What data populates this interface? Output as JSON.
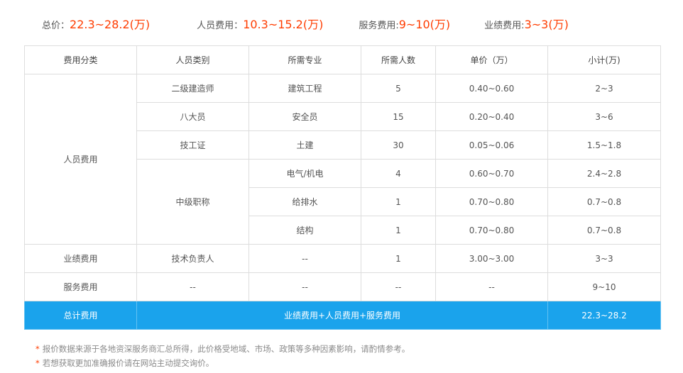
{
  "summary": {
    "total_label": "总价：",
    "total_value": "22.3~28.2(万)",
    "personnel_label": "人员费用：",
    "personnel_value": "10.3~15.2(万)",
    "service_label": "服务费用:",
    "service_value": "9~10(万)",
    "performance_label": "业绩费用:",
    "performance_value": "3~3(万)"
  },
  "table": {
    "headers": [
      "费用分类",
      "人员类别",
      "所需专业",
      "所需人数",
      "单价（万）",
      "小计(万)"
    ],
    "personnel_group": "人员费用",
    "rows": [
      {
        "category": "二级建造师",
        "major": "建筑工程",
        "count": "5",
        "price": "0.40~0.60",
        "subtotal": "2~3"
      },
      {
        "category": "八大员",
        "major": "安全员",
        "count": "15",
        "price": "0.20~0.40",
        "subtotal": "3~6"
      },
      {
        "category": "技工证",
        "major": "土建",
        "count": "30",
        "price": "0.05~0.06",
        "subtotal": "1.5~1.8"
      },
      {
        "category": "中级职称",
        "major": "电气/机电",
        "count": "4",
        "price": "0.60~0.70",
        "subtotal": "2.4~2.8"
      },
      {
        "major": "给排水",
        "count": "1",
        "price": "0.70~0.80",
        "subtotal": "0.7~0.8"
      },
      {
        "major": "结构",
        "count": "1",
        "price": "0.70~0.80",
        "subtotal": "0.7~0.8"
      }
    ],
    "performance": {
      "group": "业绩费用",
      "category": "技术负责人",
      "major": "--",
      "count": "1",
      "price": "3.00~3.00",
      "subtotal": "3~3"
    },
    "service": {
      "group": "服务费用",
      "category": "--",
      "major": "--",
      "count": "--",
      "price": "--",
      "subtotal": "9~10"
    },
    "total": {
      "label": "总计费用",
      "formula": "业绩费用+人员费用+服务费用",
      "value": "22.3~28.2"
    }
  },
  "notes": {
    "star": "*",
    "line1": "报价数据来源于各地资深服务商汇总所得，此价格受地域、市场、政策等多种因素影响，请酌情参考。",
    "line2": "若想获取更加准确报价请在网站主动提交询价。"
  }
}
